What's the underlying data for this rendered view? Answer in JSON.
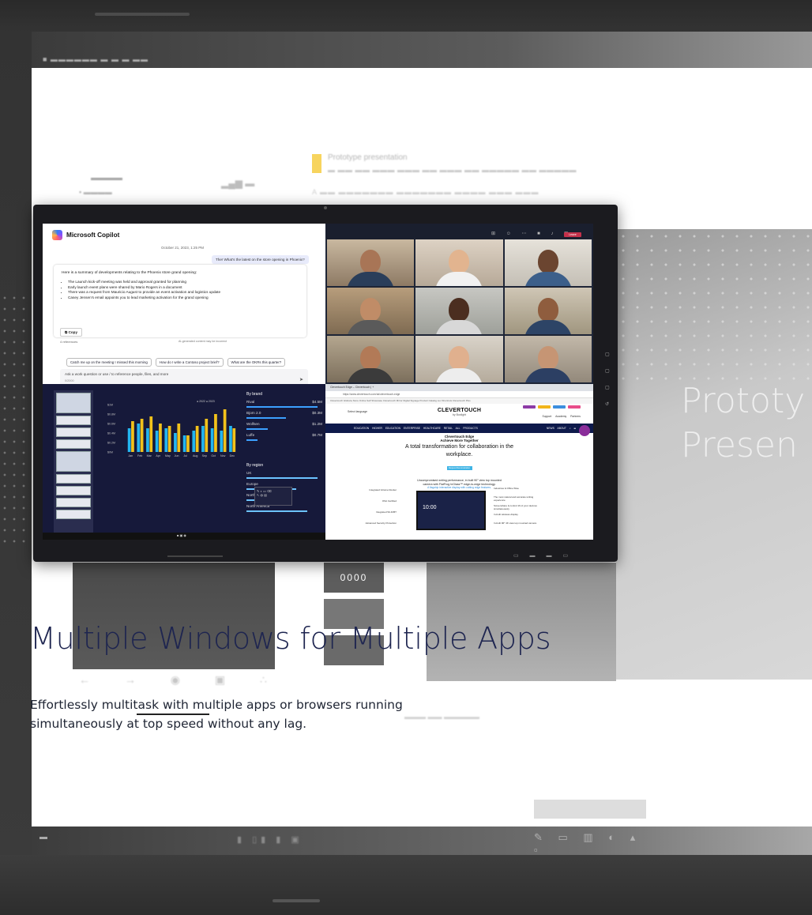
{
  "background": {
    "bar_text": "■ ▬▬▬▬▬▬  ▬ ▬  ▬ ▬▬",
    "doc_title": "Prototype presentation",
    "doc_sub": "▬ ▬▬ ▬▬ ▬▬▬ ▬▬▬ ▬▬ ▬▬▬ ▬▬ ▬▬▬▬▬ ▬▬ ▬▬▬▬▬",
    "toolbar_line": "A ▬▬  ▬▬▬▬▬▬▬  ▬▬▬▬▬▬▬  ▬▬▬▬  ▬▬▬ ▬▬▬",
    "left_label1": "▬▬▬▬",
    "left_label2": "▪ ▬▬▬▬",
    "left_icons": "▂▄▆ ▬",
    "slide_title_line1": "Prototy",
    "slide_title_line2": "Presen",
    "thumb_label": "0000",
    "footer_text": "▬▬▬ ▬▬ ▬▬▬▬▬",
    "nav_icons": "← → ◉ ▣ ∴",
    "tools_row": "✎ ▭ ▥ ◐ ▴ ▫",
    "taskbar_mid": "▮ ▯▮ ▮ ▣"
  },
  "copilot": {
    "title": "Microsoft Copilot",
    "date": "October 21, 2023, 1:25 PM",
    "user_message": "The! What's the latest on the store opening in Phoenix?",
    "answer_intro": "Here is a summary of developments relating to the Phoenix store grand opening:",
    "bullets": [
      "The Launch kick-off meeting was held and approval granted for planning",
      "Early launch event plans were shared by Mario Rogers in a document",
      "There was a request from Mauricio August to provide an event activation and logistics update",
      "Casey Jensen's email appoints you to lead marketing activation for the grand opening"
    ],
    "copy_label": "Copy",
    "refs_label": "4 references",
    "ai_note": "AI-generated content may be incorrect",
    "suggestions": [
      "Catch me up on the meeting I missed this morning",
      "How do I write a Contoso project brief?",
      "What are the OKRs this quarter?"
    ],
    "input_placeholder": "Ask a work question or use / to reference people, files, and more",
    "input_count": "0/2000"
  },
  "teams": {
    "leave_label": "Leave",
    "controls": "⊞ ☺ ⋯ ■ ♪ ⊡"
  },
  "powerbi": {
    "chart_title": "",
    "legend": "● 2022 ● 2023",
    "by_brand_label": "By brand",
    "brands": [
      {
        "name": "Rival",
        "value": "$4.5M",
        "bar": 1.0
      },
      {
        "name": "Bjorn 2.0",
        "value": "$0.3M",
        "bar": 0.55
      },
      {
        "name": "Wolfsen",
        "value": "$1.2M",
        "bar": 0.3
      },
      {
        "name": "Luffe",
        "value": "$0.7M",
        "bar": 0.15
      }
    ],
    "by_region_label": "By region",
    "regions": [
      {
        "name": "UK",
        "bar": 1.0
      },
      {
        "name": "Europe",
        "bar": 0.7
      },
      {
        "name": "North",
        "bar": 0.5
      },
      {
        "name": "North America",
        "bar": 0.85
      }
    ],
    "y_ticks": [
      "$1M",
      "$0.8M",
      "$0.6M",
      "$0.4M",
      "$0.2M",
      "$0M"
    ],
    "months": [
      "Jan",
      "Feb",
      "Mar",
      "Apr",
      "May",
      "Jun",
      "Jul",
      "Aug",
      "Sep",
      "Oct",
      "Nov",
      "Dec"
    ]
  },
  "chart_data": {
    "type": "bar",
    "categories": [
      "Jan",
      "Feb",
      "Mar",
      "Apr",
      "May",
      "Jun",
      "Jul",
      "Aug",
      "Sep",
      "Oct",
      "Nov",
      "Dec"
    ],
    "series": [
      {
        "name": "2022",
        "values": [
          0.5,
          0.6,
          0.5,
          0.45,
          0.5,
          0.4,
          0.35,
          0.45,
          0.55,
          0.5,
          0.45,
          0.55
        ]
      },
      {
        "name": "2023",
        "values": [
          0.65,
          0.7,
          0.75,
          0.6,
          0.55,
          0.6,
          0.35,
          0.55,
          0.7,
          0.8,
          0.9,
          0.5
        ]
      }
    ],
    "ylim": [
      0,
      1
    ],
    "colors": [
      "#23b5f0",
      "#f2c21b"
    ]
  },
  "browser": {
    "tabs": "Clevertouch Edge – Clevertouch   |   +",
    "url": "https://www.clevertouch.com/uk/clevertouch-edge",
    "bookmarks": "Clevertouch Global ▸  Store Online  Self Showcase  Clevertouch Mirror  Digital Signage  Product Catalog  Lux Shortcuts  Clevertouch Plus",
    "language": "Select language",
    "brand": "CLEVERTOUCH",
    "brand_by": "by Boxlight",
    "right_links": "Support  Academy  Partners",
    "nav_items": "EDUCATION   HIGHER EDUCATION   ENTERPRISE   HEALTHCARE   RETAIL   ALL PRODUCTS",
    "nav_right": "NEWS  ABOUT  ⌕  ☰",
    "hero_h1_line1": "Clevertouch Edge",
    "hero_h1_line2": "Achieve More Together",
    "hero_h2_line1": "A total transformation for collaboration in the",
    "hero_h2_line2": "workplace.",
    "cta": "Request Demonstration",
    "para_line1": "Uncompromised writing performance, in built 90° view top mounted",
    "para_line2": "camera with FlatFrog InGlass™ edge-to-edge technology.",
    "link_text": "A flagship interactive display with cutting edge features.",
    "device_time": "10:00",
    "features_left": [
      "Integrated Volume Rocker",
      "OSA Certified",
      "Integrated Wi-Fi/BT",
      "Advanced Security Protection"
    ],
    "features_right": [
      "Industries & Office Wise",
      "The most natural and accurate writing experience",
      "Screenshare & control 16 of your devices simultaneously",
      "In-built wireless display",
      "In-built 90° 4K view top mounted camera"
    ]
  },
  "hero": {
    "title": "Multiple Windows for Multiple Apps",
    "body_line1": "Effortlessly multitask with multiple apps or browsers running",
    "body_line2": "simultaneously at top speed without any lag."
  }
}
